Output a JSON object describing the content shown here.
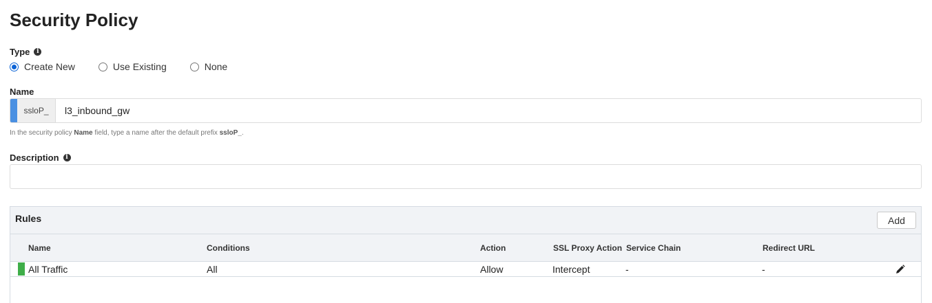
{
  "page": {
    "title": "Security Policy"
  },
  "type_field": {
    "label": "Type",
    "options": [
      {
        "label": "Create New",
        "checked": true
      },
      {
        "label": "Use Existing",
        "checked": false
      },
      {
        "label": "None",
        "checked": false
      }
    ]
  },
  "name_field": {
    "label": "Name",
    "prefix": "ssloP_",
    "value": "l3_inbound_gw",
    "help_pre": "In the security policy ",
    "help_bold1": "Name",
    "help_mid": " field, type a name after the default prefix ",
    "help_bold2": "ssloP_",
    "help_post": "."
  },
  "description_field": {
    "label": "Description",
    "value": ""
  },
  "rules": {
    "title": "Rules",
    "add_label": "Add",
    "columns": [
      "Name",
      "Conditions",
      "Action",
      "SSL Proxy Action",
      "Service Chain",
      "Redirect URL"
    ],
    "rows": [
      {
        "name": "All Traffic",
        "conditions": "All",
        "action": "Allow",
        "ssl_proxy_action": "Intercept",
        "service_chain": "-",
        "redirect_url": "-",
        "status_color": "#3fae49"
      }
    ]
  },
  "colors": {
    "accent": "#4a90e2",
    "radio_selected": "#0b63d6",
    "row_status": "#3fae49"
  },
  "icons": [
    "info-icon",
    "pencil-icon"
  ]
}
